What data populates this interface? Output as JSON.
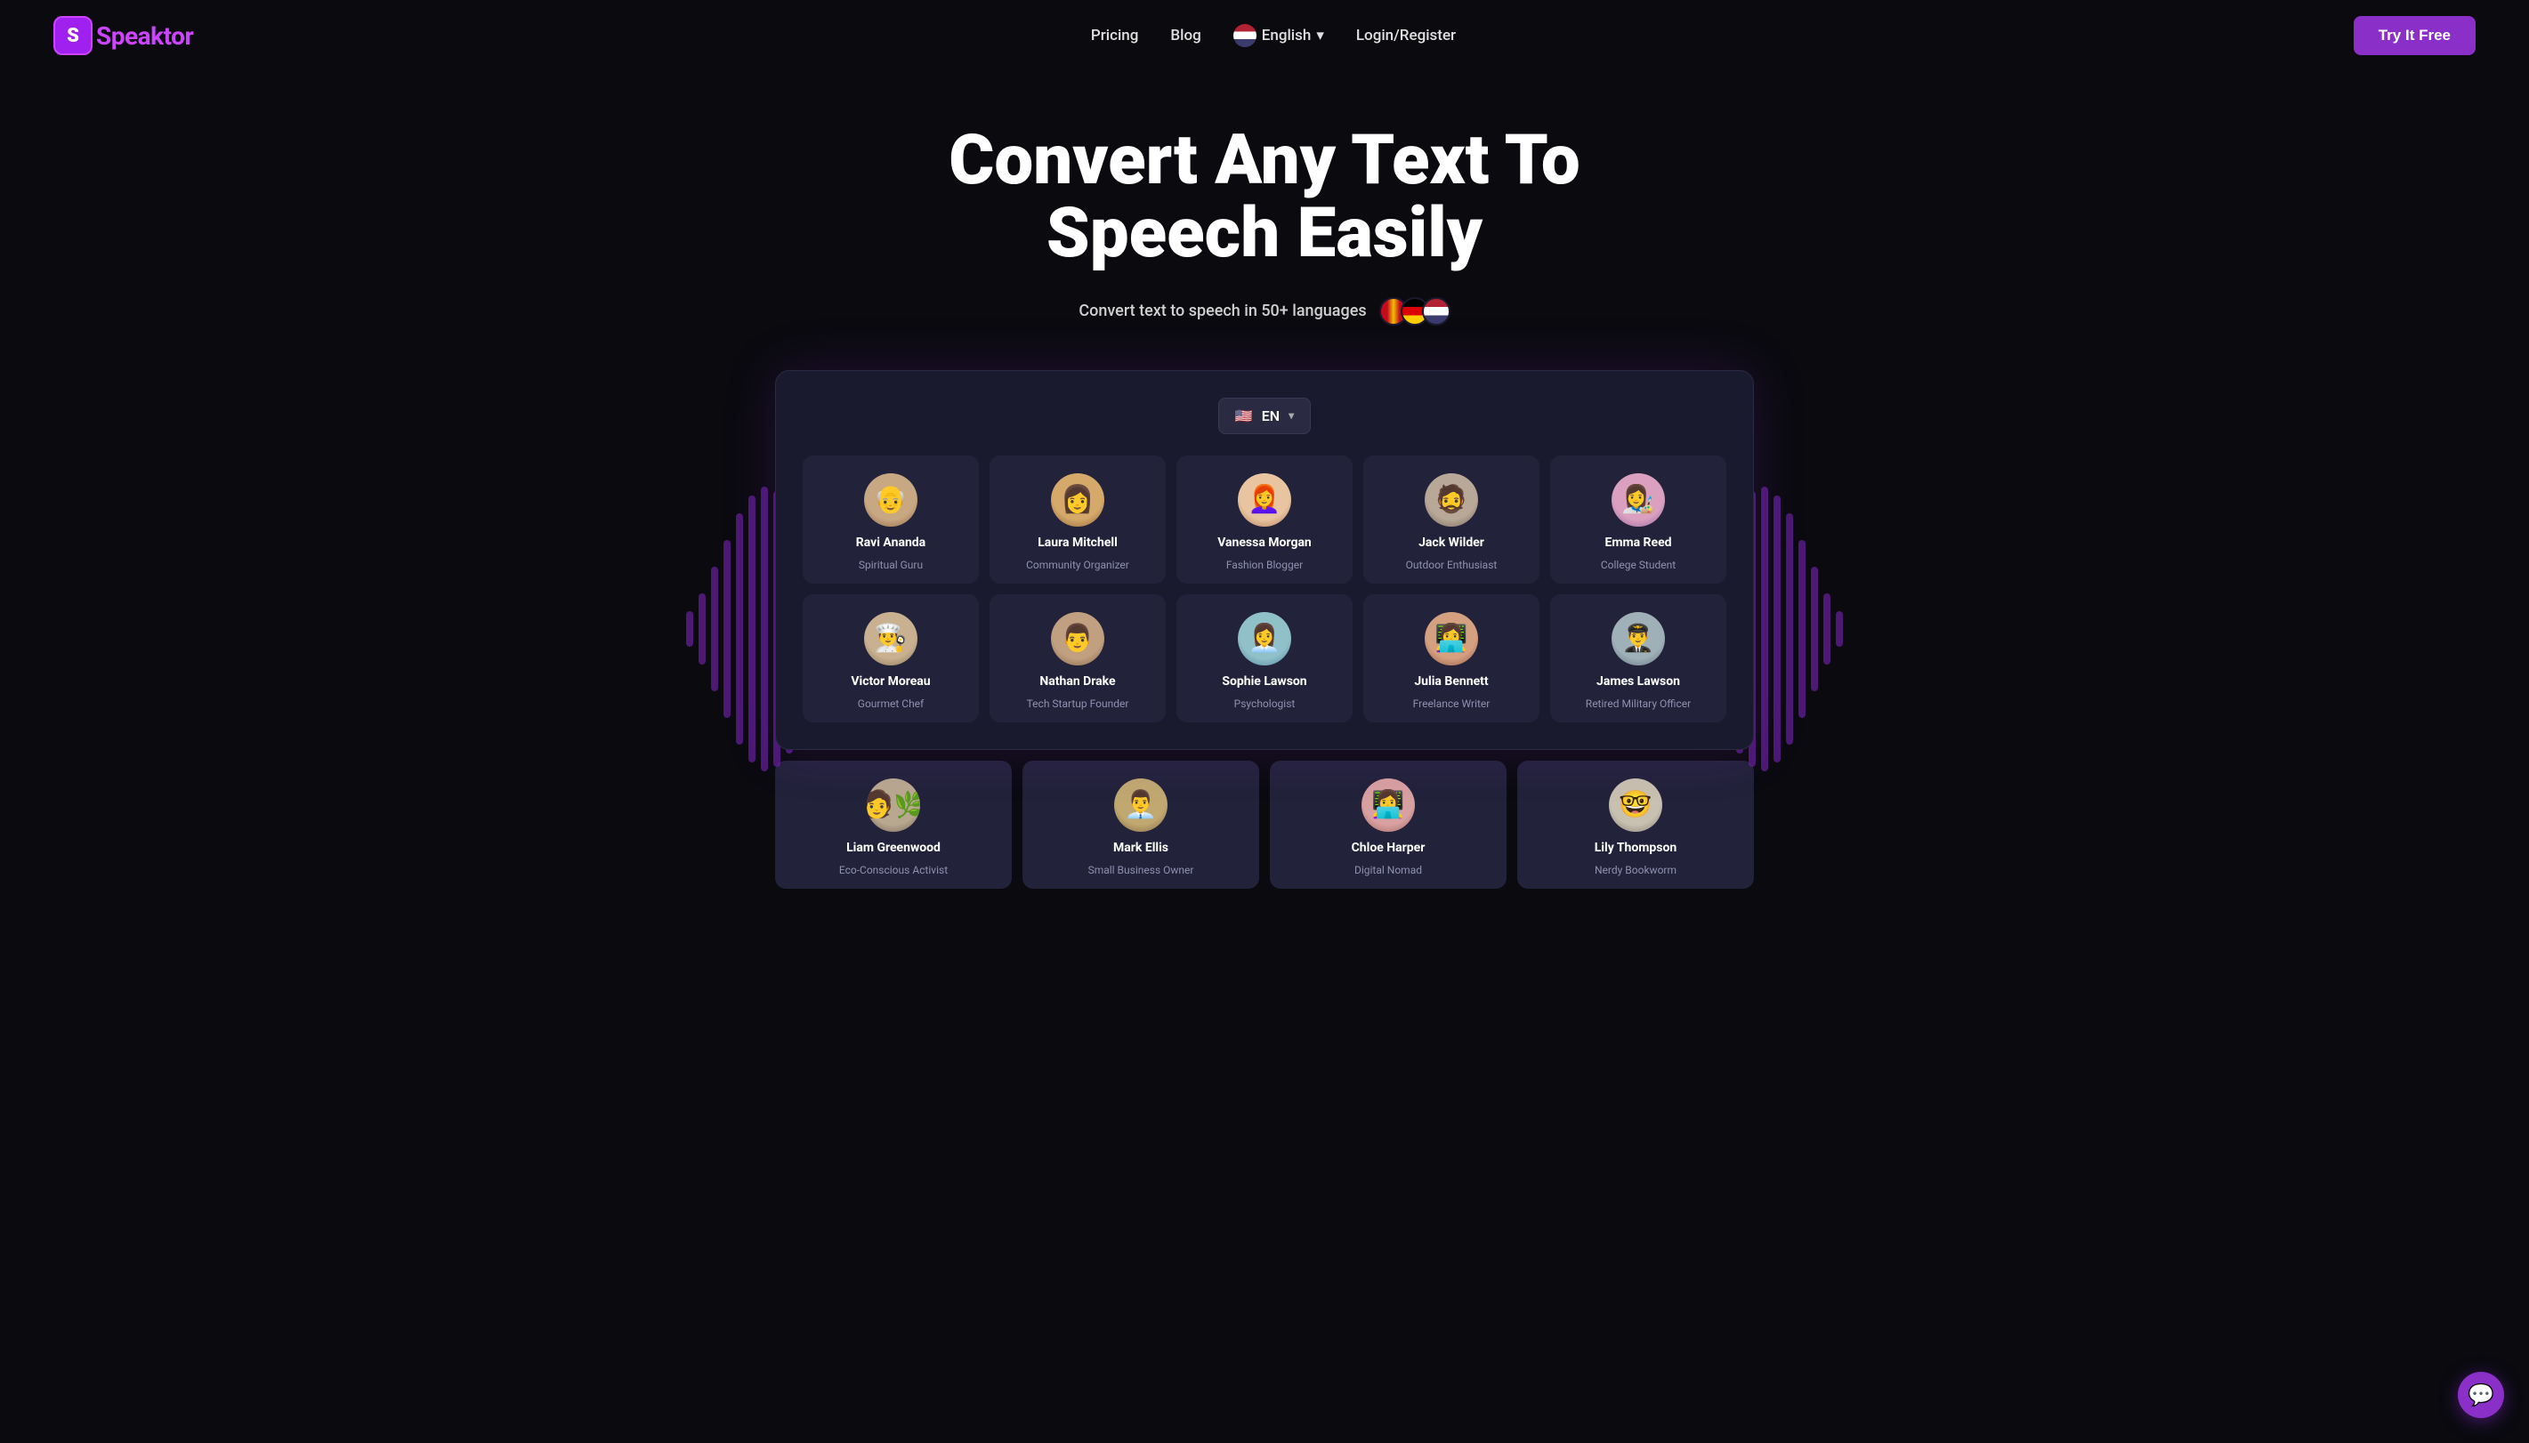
{
  "nav": {
    "logo_text": "peaktor",
    "logo_letter": "S",
    "links": [
      {
        "label": "Pricing",
        "id": "pricing"
      },
      {
        "label": "Blog",
        "id": "blog"
      }
    ],
    "lang_label": "English",
    "login_label": "Login/Register",
    "try_label": "Try It Free"
  },
  "hero": {
    "title": "Convert Any Text To Speech Easily",
    "subtitle": "Convert text to speech in 50+ languages"
  },
  "app": {
    "lang_selector": {
      "flag": "🇺🇸",
      "code": "EN",
      "chevron": "▾"
    },
    "voices": [
      {
        "id": "ravi",
        "name": "Ravi Ananda",
        "role": "Spiritual Guru",
        "av_class": "av-ravi",
        "emoji": "👴"
      },
      {
        "id": "laura",
        "name": "Laura Mitchell",
        "role": "Community Organizer",
        "av_class": "av-laura",
        "emoji": "👩"
      },
      {
        "id": "vanessa",
        "name": "Vanessa Morgan",
        "role": "Fashion Blogger",
        "av_class": "av-vanessa",
        "emoji": "👩‍🦰"
      },
      {
        "id": "jack",
        "name": "Jack Wilder",
        "role": "Outdoor Enthusiast",
        "av_class": "av-jack",
        "emoji": "🧔"
      },
      {
        "id": "emma",
        "name": "Emma Reed",
        "role": "College Student",
        "av_class": "av-emma",
        "emoji": "👩‍🎨"
      },
      {
        "id": "victor",
        "name": "Victor Moreau",
        "role": "Gourmet Chef",
        "av_class": "av-victor",
        "emoji": "👨‍🍳"
      },
      {
        "id": "nathan",
        "name": "Nathan Drake",
        "role": "Tech Startup Founder",
        "av_class": "av-nathan",
        "emoji": "👨"
      },
      {
        "id": "sophie",
        "name": "Sophie Lawson",
        "role": "Psychologist",
        "av_class": "av-sophie",
        "emoji": "👩‍💼"
      },
      {
        "id": "julia",
        "name": "Julia Bennett",
        "role": "Freelance Writer",
        "av_class": "av-julia",
        "emoji": "👩‍💻"
      },
      {
        "id": "james",
        "name": "James Lawson",
        "role": "Retired Military Officer",
        "av_class": "av-james",
        "emoji": "👨‍✈️"
      }
    ],
    "voices_row3": [
      {
        "id": "liam",
        "name": "Liam Greenwood",
        "role": "Eco-Conscious Activist",
        "av_class": "av-liam",
        "emoji": "🧑‍🌿"
      },
      {
        "id": "mark",
        "name": "Mark Ellis",
        "role": "Small Business Owner",
        "av_class": "av-mark",
        "emoji": "👨‍💼"
      },
      {
        "id": "chloe",
        "name": "Chloe Harper",
        "role": "Digital Nomad",
        "av_class": "av-chloe",
        "emoji": "👩‍💻"
      },
      {
        "id": "lily",
        "name": "Lily Thompson",
        "role": "Nerdy Bookworm",
        "av_class": "av-lily",
        "emoji": "🤓"
      }
    ]
  },
  "chat_icon": "💬"
}
